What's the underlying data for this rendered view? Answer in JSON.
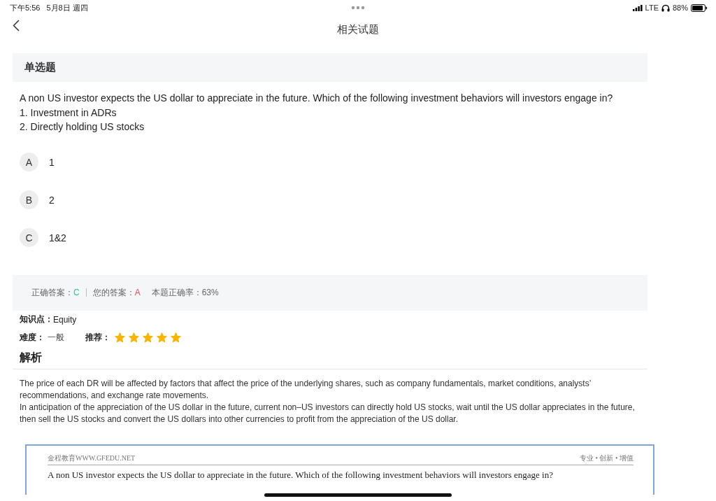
{
  "status_bar": {
    "time": "下午5:56",
    "date": "5月8日 週四",
    "network": "LTE",
    "battery": "88%"
  },
  "nav": {
    "title": "相关试题"
  },
  "question": {
    "type_label": "单选题",
    "lines": [
      "A non US investor expects the US dollar to appreciate in the future. Which of the following investment behaviors will investors engage in?",
      "1. Investment in ADRs",
      "2. Directly holding US stocks"
    ],
    "options": [
      {
        "letter": "A",
        "text": "1",
        "selected": false
      },
      {
        "letter": "B",
        "text": "2",
        "selected": false
      },
      {
        "letter": "C",
        "text": "1&2",
        "selected": false
      }
    ]
  },
  "result": {
    "correct_label": "正确答案：",
    "correct": "C",
    "yours_label": "您的答案：",
    "yours": "A",
    "rate_label": "本题正确率：",
    "rate": "63%"
  },
  "knowledge": {
    "label": "知识点：",
    "value": "Equity"
  },
  "difficulty": {
    "label": "难度：",
    "value": "一般"
  },
  "recommend": {
    "label": "推荐：",
    "stars": 5
  },
  "analysis": {
    "title": "解析",
    "paragraphs": [
      "The price of each DR will be affected by factors that affect the price of the underlying shares, such as company fundamentals, market conditions, analysts’ recommendations, and exchange rate movements.",
      "In anticipation of the appreciation of the US dollar in the future, current non–US investors can directly hold US stocks, wait until the US dollar appreciates in the future, then sell the US stocks and convert the US dollars into other currencies to profit from the appreciation of the US dollar."
    ]
  },
  "document": {
    "header_left": "金程教育WWW.GFEDU.NET",
    "header_right": "专业 • 创新 • 增值",
    "first_line": "A non US investor expects the US dollar to appreciate in the future. Which of the following investment behaviors will investors engage in?"
  }
}
